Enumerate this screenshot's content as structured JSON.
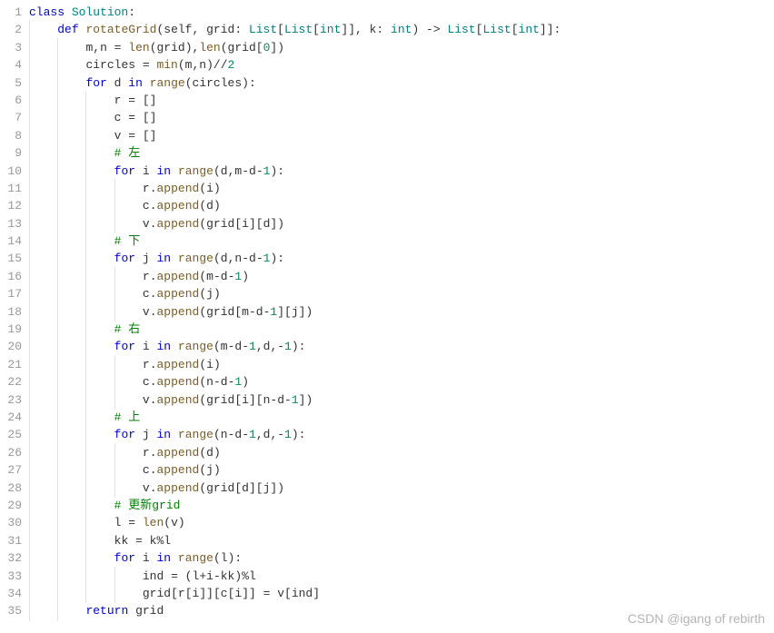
{
  "watermark": "CSDN @igang of rebirth",
  "lines": [
    {
      "n": 1,
      "indent": 0,
      "tokens": [
        [
          "kw",
          "class"
        ],
        [
          "txt",
          " "
        ],
        [
          "cls",
          "Solution"
        ],
        [
          "sym",
          ":"
        ]
      ]
    },
    {
      "n": 2,
      "indent": 1,
      "tokens": [
        [
          "kw",
          "def"
        ],
        [
          "txt",
          " "
        ],
        [
          "def",
          "rotateGrid"
        ],
        [
          "sym",
          "("
        ],
        [
          "var",
          "self"
        ],
        [
          "sym",
          ", "
        ],
        [
          "var",
          "grid"
        ],
        [
          "sym",
          ": "
        ],
        [
          "type",
          "List"
        ],
        [
          "sym",
          "["
        ],
        [
          "type",
          "List"
        ],
        [
          "sym",
          "["
        ],
        [
          "type",
          "int"
        ],
        [
          "sym",
          "]], "
        ],
        [
          "var",
          "k"
        ],
        [
          "sym",
          ": "
        ],
        [
          "type",
          "int"
        ],
        [
          "sym",
          ") -> "
        ],
        [
          "type",
          "List"
        ],
        [
          "sym",
          "["
        ],
        [
          "type",
          "List"
        ],
        [
          "sym",
          "["
        ],
        [
          "type",
          "int"
        ],
        [
          "sym",
          "]]:"
        ]
      ]
    },
    {
      "n": 3,
      "indent": 2,
      "tokens": [
        [
          "var",
          "m"
        ],
        [
          "sym",
          ","
        ],
        [
          "var",
          "n"
        ],
        [
          "sym",
          " = "
        ],
        [
          "def",
          "len"
        ],
        [
          "sym",
          "("
        ],
        [
          "var",
          "grid"
        ],
        [
          "sym",
          "),"
        ],
        [
          "def",
          "len"
        ],
        [
          "sym",
          "("
        ],
        [
          "var",
          "grid"
        ],
        [
          "sym",
          "["
        ],
        [
          "num",
          "0"
        ],
        [
          "sym",
          "])"
        ]
      ]
    },
    {
      "n": 4,
      "indent": 2,
      "tokens": [
        [
          "var",
          "circles"
        ],
        [
          "sym",
          " = "
        ],
        [
          "def",
          "min"
        ],
        [
          "sym",
          "("
        ],
        [
          "var",
          "m"
        ],
        [
          "sym",
          ","
        ],
        [
          "var",
          "n"
        ],
        [
          "sym",
          ")//"
        ],
        [
          "num",
          "2"
        ]
      ]
    },
    {
      "n": 5,
      "indent": 2,
      "tokens": [
        [
          "kw",
          "for"
        ],
        [
          "txt",
          " "
        ],
        [
          "var",
          "d"
        ],
        [
          "txt",
          " "
        ],
        [
          "kw",
          "in"
        ],
        [
          "txt",
          " "
        ],
        [
          "def",
          "range"
        ],
        [
          "sym",
          "("
        ],
        [
          "var",
          "circles"
        ],
        [
          "sym",
          "):"
        ]
      ]
    },
    {
      "n": 6,
      "indent": 3,
      "tokens": [
        [
          "var",
          "r"
        ],
        [
          "sym",
          " = []"
        ]
      ]
    },
    {
      "n": 7,
      "indent": 3,
      "tokens": [
        [
          "var",
          "c"
        ],
        [
          "sym",
          " = []"
        ]
      ]
    },
    {
      "n": 8,
      "indent": 3,
      "tokens": [
        [
          "var",
          "v"
        ],
        [
          "sym",
          " = []"
        ]
      ]
    },
    {
      "n": 9,
      "indent": 3,
      "tokens": [
        [
          "cmt",
          "# 左"
        ]
      ]
    },
    {
      "n": 10,
      "indent": 3,
      "tokens": [
        [
          "kw",
          "for"
        ],
        [
          "txt",
          " "
        ],
        [
          "var",
          "i"
        ],
        [
          "txt",
          " "
        ],
        [
          "kw",
          "in"
        ],
        [
          "txt",
          " "
        ],
        [
          "def",
          "range"
        ],
        [
          "sym",
          "("
        ],
        [
          "var",
          "d"
        ],
        [
          "sym",
          ","
        ],
        [
          "var",
          "m"
        ],
        [
          "sym",
          "-"
        ],
        [
          "var",
          "d"
        ],
        [
          "sym",
          "-"
        ],
        [
          "num",
          "1"
        ],
        [
          "sym",
          "):"
        ]
      ]
    },
    {
      "n": 11,
      "indent": 4,
      "tokens": [
        [
          "var",
          "r"
        ],
        [
          "sym",
          "."
        ],
        [
          "def",
          "append"
        ],
        [
          "sym",
          "("
        ],
        [
          "var",
          "i"
        ],
        [
          "sym",
          ")"
        ]
      ]
    },
    {
      "n": 12,
      "indent": 4,
      "tokens": [
        [
          "var",
          "c"
        ],
        [
          "sym",
          "."
        ],
        [
          "def",
          "append"
        ],
        [
          "sym",
          "("
        ],
        [
          "var",
          "d"
        ],
        [
          "sym",
          ")"
        ]
      ]
    },
    {
      "n": 13,
      "indent": 4,
      "tokens": [
        [
          "var",
          "v"
        ],
        [
          "sym",
          "."
        ],
        [
          "def",
          "append"
        ],
        [
          "sym",
          "("
        ],
        [
          "var",
          "grid"
        ],
        [
          "sym",
          "["
        ],
        [
          "var",
          "i"
        ],
        [
          "sym",
          "]["
        ],
        [
          "var",
          "d"
        ],
        [
          "sym",
          "])"
        ]
      ]
    },
    {
      "n": 14,
      "indent": 3,
      "tokens": [
        [
          "cmt",
          "# 下"
        ]
      ]
    },
    {
      "n": 15,
      "indent": 3,
      "tokens": [
        [
          "kw",
          "for"
        ],
        [
          "txt",
          " "
        ],
        [
          "var",
          "j"
        ],
        [
          "txt",
          " "
        ],
        [
          "kw",
          "in"
        ],
        [
          "txt",
          " "
        ],
        [
          "def",
          "range"
        ],
        [
          "sym",
          "("
        ],
        [
          "var",
          "d"
        ],
        [
          "sym",
          ","
        ],
        [
          "var",
          "n"
        ],
        [
          "sym",
          "-"
        ],
        [
          "var",
          "d"
        ],
        [
          "sym",
          "-"
        ],
        [
          "num",
          "1"
        ],
        [
          "sym",
          "):"
        ]
      ]
    },
    {
      "n": 16,
      "indent": 4,
      "tokens": [
        [
          "var",
          "r"
        ],
        [
          "sym",
          "."
        ],
        [
          "def",
          "append"
        ],
        [
          "sym",
          "("
        ],
        [
          "var",
          "m"
        ],
        [
          "sym",
          "-"
        ],
        [
          "var",
          "d"
        ],
        [
          "sym",
          "-"
        ],
        [
          "num",
          "1"
        ],
        [
          "sym",
          ")"
        ]
      ]
    },
    {
      "n": 17,
      "indent": 4,
      "tokens": [
        [
          "var",
          "c"
        ],
        [
          "sym",
          "."
        ],
        [
          "def",
          "append"
        ],
        [
          "sym",
          "("
        ],
        [
          "var",
          "j"
        ],
        [
          "sym",
          ")"
        ]
      ]
    },
    {
      "n": 18,
      "indent": 4,
      "tokens": [
        [
          "var",
          "v"
        ],
        [
          "sym",
          "."
        ],
        [
          "def",
          "append"
        ],
        [
          "sym",
          "("
        ],
        [
          "var",
          "grid"
        ],
        [
          "sym",
          "["
        ],
        [
          "var",
          "m"
        ],
        [
          "sym",
          "-"
        ],
        [
          "var",
          "d"
        ],
        [
          "sym",
          "-"
        ],
        [
          "num",
          "1"
        ],
        [
          "sym",
          "]["
        ],
        [
          "var",
          "j"
        ],
        [
          "sym",
          "])"
        ]
      ]
    },
    {
      "n": 19,
      "indent": 3,
      "tokens": [
        [
          "cmt",
          "# 右"
        ]
      ]
    },
    {
      "n": 20,
      "indent": 3,
      "tokens": [
        [
          "kw",
          "for"
        ],
        [
          "txt",
          " "
        ],
        [
          "var",
          "i"
        ],
        [
          "txt",
          " "
        ],
        [
          "kw",
          "in"
        ],
        [
          "txt",
          " "
        ],
        [
          "def",
          "range"
        ],
        [
          "sym",
          "("
        ],
        [
          "var",
          "m"
        ],
        [
          "sym",
          "-"
        ],
        [
          "var",
          "d"
        ],
        [
          "sym",
          "-"
        ],
        [
          "num",
          "1"
        ],
        [
          "sym",
          ","
        ],
        [
          "var",
          "d"
        ],
        [
          "sym",
          ",-"
        ],
        [
          "num",
          "1"
        ],
        [
          "sym",
          "):"
        ]
      ]
    },
    {
      "n": 21,
      "indent": 4,
      "tokens": [
        [
          "var",
          "r"
        ],
        [
          "sym",
          "."
        ],
        [
          "def",
          "append"
        ],
        [
          "sym",
          "("
        ],
        [
          "var",
          "i"
        ],
        [
          "sym",
          ")"
        ]
      ]
    },
    {
      "n": 22,
      "indent": 4,
      "tokens": [
        [
          "var",
          "c"
        ],
        [
          "sym",
          "."
        ],
        [
          "def",
          "append"
        ],
        [
          "sym",
          "("
        ],
        [
          "var",
          "n"
        ],
        [
          "sym",
          "-"
        ],
        [
          "var",
          "d"
        ],
        [
          "sym",
          "-"
        ],
        [
          "num",
          "1"
        ],
        [
          "sym",
          ")"
        ]
      ]
    },
    {
      "n": 23,
      "indent": 4,
      "tokens": [
        [
          "var",
          "v"
        ],
        [
          "sym",
          "."
        ],
        [
          "def",
          "append"
        ],
        [
          "sym",
          "("
        ],
        [
          "var",
          "grid"
        ],
        [
          "sym",
          "["
        ],
        [
          "var",
          "i"
        ],
        [
          "sym",
          "]["
        ],
        [
          "var",
          "n"
        ],
        [
          "sym",
          "-"
        ],
        [
          "var",
          "d"
        ],
        [
          "sym",
          "-"
        ],
        [
          "num",
          "1"
        ],
        [
          "sym",
          "])"
        ]
      ]
    },
    {
      "n": 24,
      "indent": 3,
      "tokens": [
        [
          "cmt",
          "# 上"
        ]
      ]
    },
    {
      "n": 25,
      "indent": 3,
      "tokens": [
        [
          "kw",
          "for"
        ],
        [
          "txt",
          " "
        ],
        [
          "var",
          "j"
        ],
        [
          "txt",
          " "
        ],
        [
          "kw",
          "in"
        ],
        [
          "txt",
          " "
        ],
        [
          "def",
          "range"
        ],
        [
          "sym",
          "("
        ],
        [
          "var",
          "n"
        ],
        [
          "sym",
          "-"
        ],
        [
          "var",
          "d"
        ],
        [
          "sym",
          "-"
        ],
        [
          "num",
          "1"
        ],
        [
          "sym",
          ","
        ],
        [
          "var",
          "d"
        ],
        [
          "sym",
          ",-"
        ],
        [
          "num",
          "1"
        ],
        [
          "sym",
          "):"
        ]
      ]
    },
    {
      "n": 26,
      "indent": 4,
      "tokens": [
        [
          "var",
          "r"
        ],
        [
          "sym",
          "."
        ],
        [
          "def",
          "append"
        ],
        [
          "sym",
          "("
        ],
        [
          "var",
          "d"
        ],
        [
          "sym",
          ")"
        ]
      ]
    },
    {
      "n": 27,
      "indent": 4,
      "tokens": [
        [
          "var",
          "c"
        ],
        [
          "sym",
          "."
        ],
        [
          "def",
          "append"
        ],
        [
          "sym",
          "("
        ],
        [
          "var",
          "j"
        ],
        [
          "sym",
          ")"
        ]
      ]
    },
    {
      "n": 28,
      "indent": 4,
      "tokens": [
        [
          "var",
          "v"
        ],
        [
          "sym",
          "."
        ],
        [
          "def",
          "append"
        ],
        [
          "sym",
          "("
        ],
        [
          "var",
          "grid"
        ],
        [
          "sym",
          "["
        ],
        [
          "var",
          "d"
        ],
        [
          "sym",
          "]["
        ],
        [
          "var",
          "j"
        ],
        [
          "sym",
          "])"
        ]
      ]
    },
    {
      "n": 29,
      "indent": 3,
      "tokens": [
        [
          "cmt",
          "# 更新grid"
        ]
      ]
    },
    {
      "n": 30,
      "indent": 3,
      "tokens": [
        [
          "var",
          "l"
        ],
        [
          "sym",
          " = "
        ],
        [
          "def",
          "len"
        ],
        [
          "sym",
          "("
        ],
        [
          "var",
          "v"
        ],
        [
          "sym",
          ")"
        ]
      ]
    },
    {
      "n": 31,
      "indent": 3,
      "tokens": [
        [
          "var",
          "kk"
        ],
        [
          "sym",
          " = "
        ],
        [
          "var",
          "k"
        ],
        [
          "sym",
          "%"
        ],
        [
          "var",
          "l"
        ]
      ]
    },
    {
      "n": 32,
      "indent": 3,
      "tokens": [
        [
          "kw",
          "for"
        ],
        [
          "txt",
          " "
        ],
        [
          "var",
          "i"
        ],
        [
          "txt",
          " "
        ],
        [
          "kw",
          "in"
        ],
        [
          "txt",
          " "
        ],
        [
          "def",
          "range"
        ],
        [
          "sym",
          "("
        ],
        [
          "var",
          "l"
        ],
        [
          "sym",
          "):"
        ]
      ]
    },
    {
      "n": 33,
      "indent": 4,
      "tokens": [
        [
          "var",
          "ind"
        ],
        [
          "sym",
          " = ("
        ],
        [
          "var",
          "l"
        ],
        [
          "sym",
          "+"
        ],
        [
          "var",
          "i"
        ],
        [
          "sym",
          "-"
        ],
        [
          "var",
          "kk"
        ],
        [
          "sym",
          ")%"
        ],
        [
          "var",
          "l"
        ]
      ]
    },
    {
      "n": 34,
      "indent": 4,
      "tokens": [
        [
          "var",
          "grid"
        ],
        [
          "sym",
          "["
        ],
        [
          "var",
          "r"
        ],
        [
          "sym",
          "["
        ],
        [
          "var",
          "i"
        ],
        [
          "sym",
          "]]["
        ],
        [
          "var",
          "c"
        ],
        [
          "sym",
          "["
        ],
        [
          "var",
          "i"
        ],
        [
          "sym",
          "]] = "
        ],
        [
          "var",
          "v"
        ],
        [
          "sym",
          "["
        ],
        [
          "var",
          "ind"
        ],
        [
          "sym",
          "]"
        ]
      ]
    },
    {
      "n": 35,
      "indent": 2,
      "tokens": [
        [
          "kw",
          "return"
        ],
        [
          "txt",
          " "
        ],
        [
          "var",
          "grid"
        ]
      ]
    }
  ]
}
